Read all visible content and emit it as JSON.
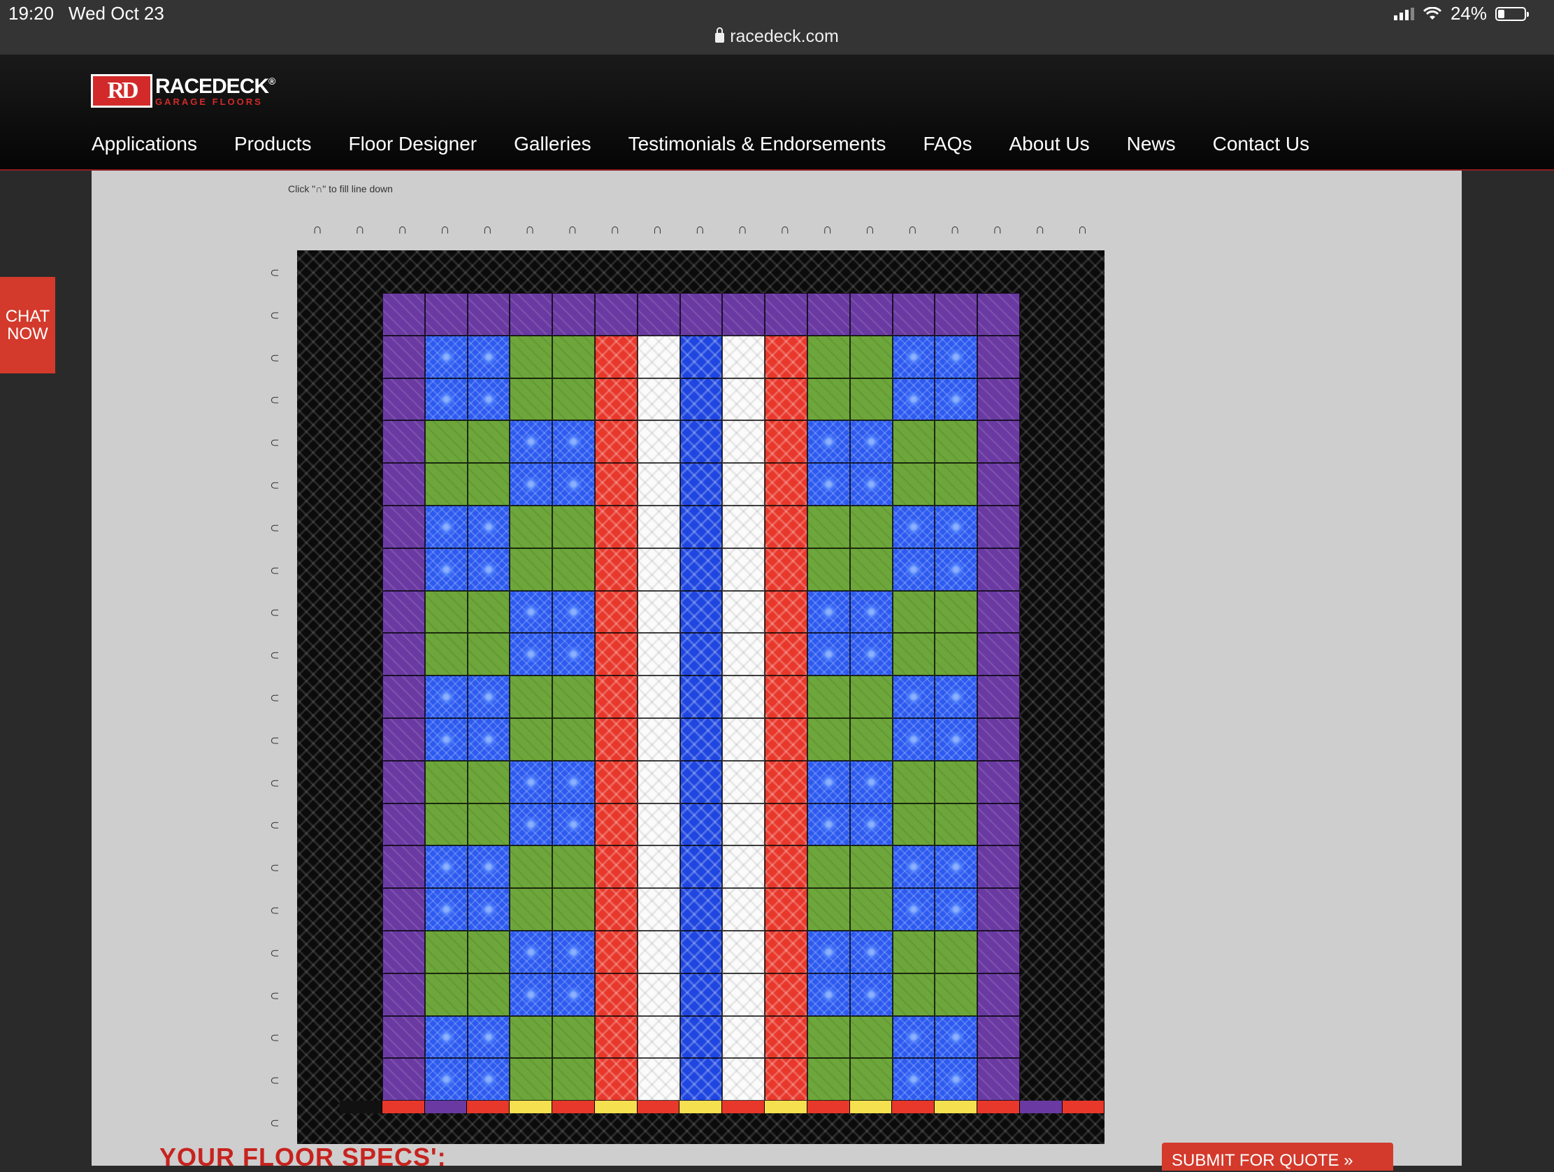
{
  "status_bar": {
    "time": "19:20",
    "date": "Wed Oct 23",
    "battery": "24%",
    "battery_level": 0.24
  },
  "browser": {
    "url": "racedeck.com"
  },
  "logo": {
    "brand_race": "RACE",
    "brand_deck": "DECK",
    "brand_suffix": "®",
    "tagline": "GARAGE FLOORS",
    "mark": "RD"
  },
  "nav": {
    "items": [
      "Applications",
      "Products",
      "Floor Designer",
      "Galleries",
      "Testimonials & Endorsements",
      "FAQs",
      "About Us",
      "News",
      "Contact Us"
    ]
  },
  "chat": {
    "line1": "CHAT",
    "line2": "NOW"
  },
  "designer": {
    "hint_top": "Click \"∩\" to fill line down",
    "hint_left": "Click \"∩\" to fill line down",
    "column_count": 19,
    "row_count": 21,
    "fill_arrow": "∩",
    "tile_colors": {
      "p": "#6a3aa2",
      "b": "#2d5bf0",
      "g": "#6da63a",
      "r": "#e8382b",
      "w": "#fbfbfb",
      "k": "#111111",
      "y": "#f5e050"
    },
    "pattern_rows": [
      "kkppppppppppppppppkk",
      "kkpbbggrwBwrggbbpkk",
      "kkpggbbrwBwrbbggpkk"
    ],
    "edge_row": "k r p r y r y r y r y r y r y r p r k"
  },
  "footer": {
    "specs_title": "YOUR FLOOR SPECS':",
    "submit_label": "SUBMIT FOR QUOTE »"
  }
}
